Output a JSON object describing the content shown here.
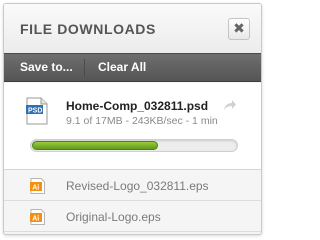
{
  "panel": {
    "title": "FILE DOWNLOADS",
    "close_label": "✖"
  },
  "toolbar": {
    "save_label": "Save to...",
    "clear_label": "Clear All"
  },
  "active_download": {
    "filename": "Home-Comp_032811.psd",
    "meta": "9.1 of 17MB - 243KB/sec - 1 min",
    "file_type": "PSD",
    "progress": 0.62,
    "icon": "psd-file-icon"
  },
  "downloads": [
    {
      "filename": "Revised-Logo_032811.eps",
      "file_type": "Ai",
      "icon": "ai-file-icon"
    },
    {
      "filename": "Original-Logo.eps",
      "file_type": "Ai",
      "icon": "ai-file-icon"
    }
  ],
  "colors": {
    "toolbar": "#555555",
    "progress": "#7ab52a",
    "ai_icon": "#f29111",
    "psd_icon": "#2f6fb5"
  }
}
